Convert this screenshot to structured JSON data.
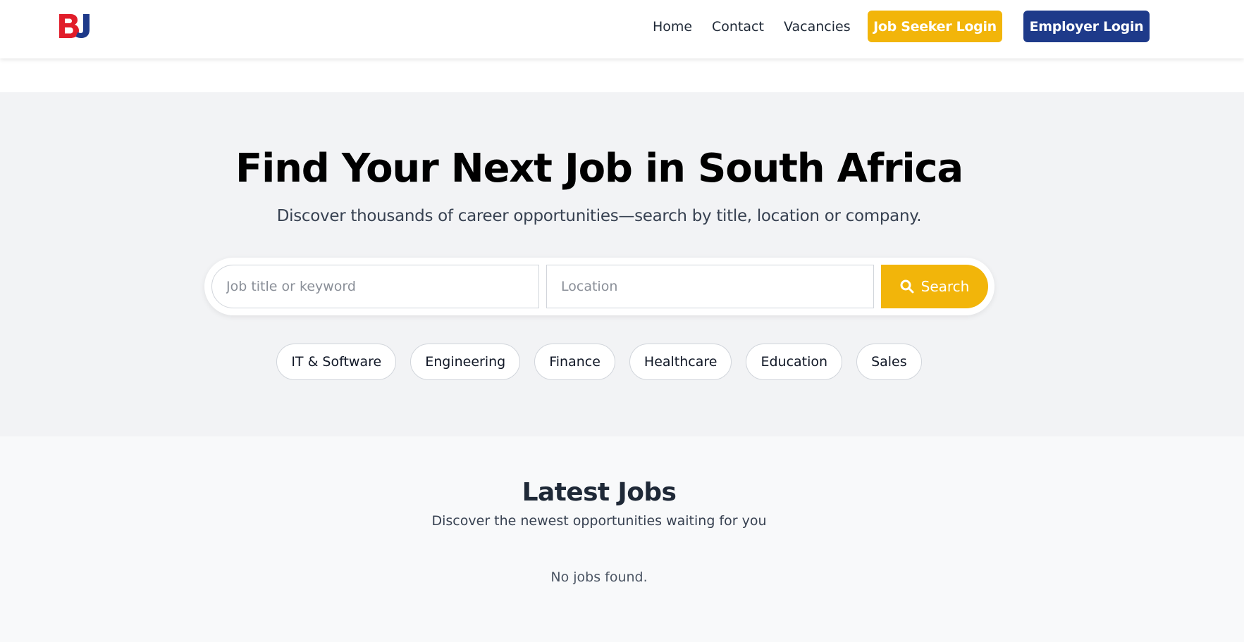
{
  "header": {
    "logo_text": "BJ",
    "nav": {
      "home": "Home",
      "contact": "Contact",
      "vacancies": "Vacancies"
    },
    "job_seeker_login": "Job Seeker Login",
    "employer_login": "Employer Login"
  },
  "hero": {
    "title": "Find Your Next Job in South Africa",
    "subtitle": "Discover thousands of career opportunities—search by title, location or company.",
    "search": {
      "keyword_placeholder": "Job title or keyword",
      "keyword_value": "",
      "location_placeholder": "Location",
      "location_value": "",
      "button_label": "Search",
      "button_icon": "search-icon"
    },
    "categories": [
      "IT & Software",
      "Engineering",
      "Finance",
      "Healthcare",
      "Education",
      "Sales"
    ]
  },
  "latest_jobs": {
    "title": "Latest Jobs",
    "subtitle": "Discover the newest opportunities waiting for you",
    "empty_message": "No jobs found."
  },
  "colors": {
    "accent_yellow": "#f2b50a",
    "brand_navy": "#1e3a8a",
    "logo_red": "#e11d2a",
    "logo_blue": "#1e3a8a",
    "hero_background": "#f2f3f5",
    "section_background": "#f8f9fa"
  }
}
